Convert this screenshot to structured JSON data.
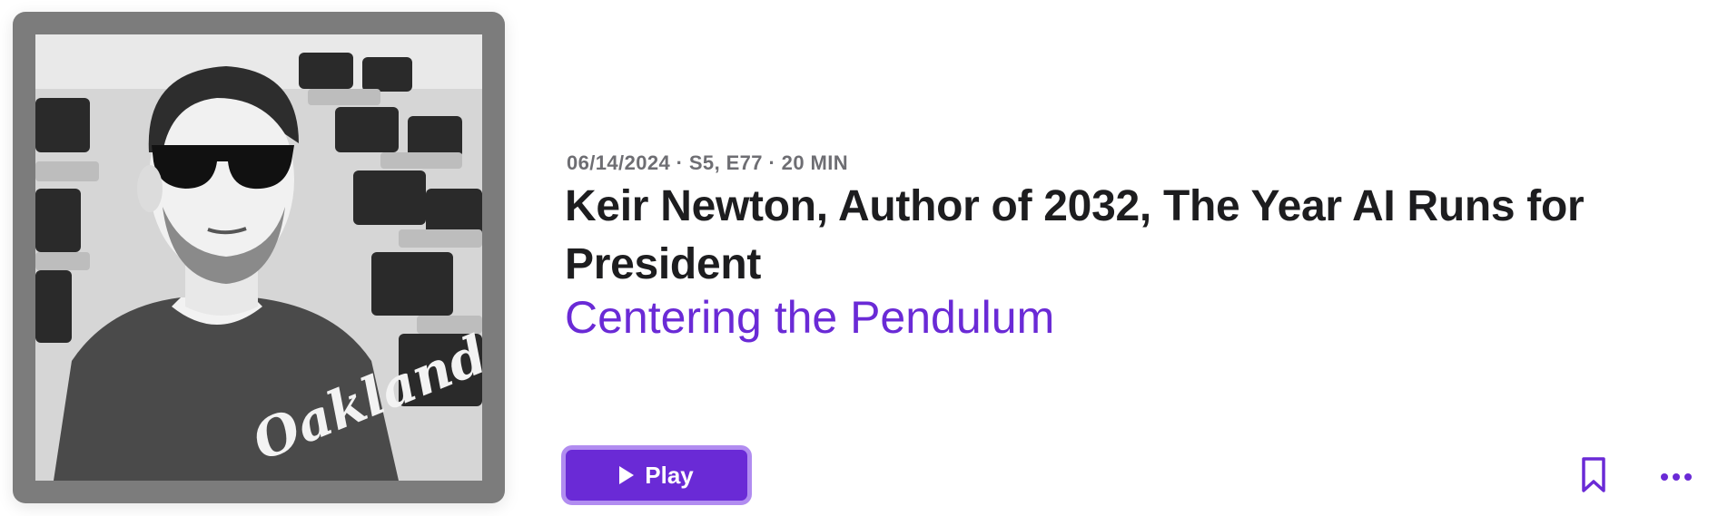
{
  "episode": {
    "meta": "06/14/2024 · S5, E77 · 20 MIN",
    "title": "Keir Newton, Author of 2032, The Year AI Runs for President",
    "show_name": "Centering the Pendulum"
  },
  "artwork": {
    "shirt_text": "Oakland",
    "icon": "podcast-artwork-photo"
  },
  "actions": {
    "play_label": "Play",
    "play_icon": "play-icon",
    "bookmark_icon": "bookmark-icon",
    "more_icon": "ellipsis-icon"
  },
  "colors": {
    "accent": "#6a2ad6",
    "accent_border": "#b18cf0",
    "title": "#1d1d1f",
    "meta": "#6e6e73",
    "frame": "#7c7c7c"
  }
}
